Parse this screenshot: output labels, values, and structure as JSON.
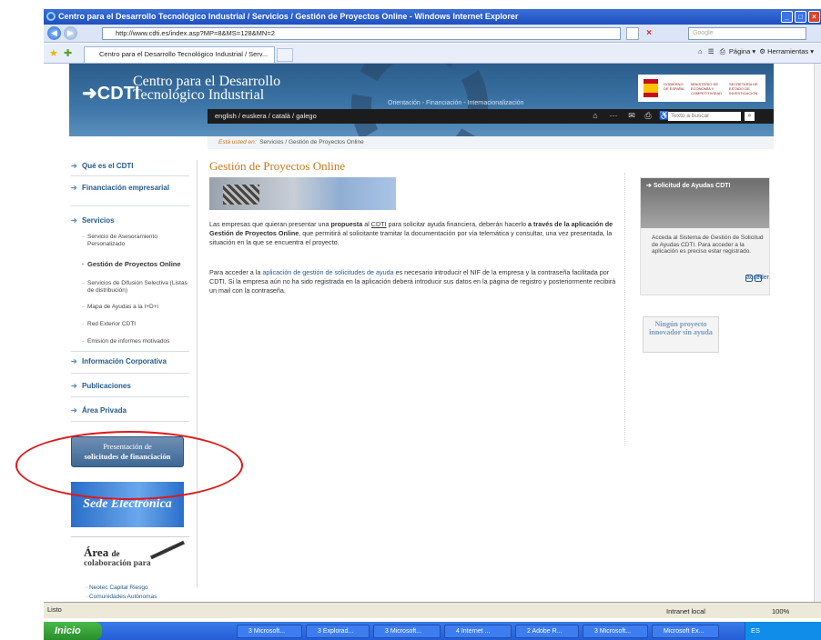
{
  "window": {
    "title": "Centro para el Desarrollo Tecnológico Industrial / Servicios / Gestión de Proyectos Online - Windows Internet Explorer"
  },
  "browser": {
    "url": "http://www.cdti.es/index.asp?MP=8&MS=128&MN=2",
    "search_placeholder": "Google",
    "tab_label": "Centro para el Desarrollo Tecnológico Industrial / Serv...",
    "page_menu": "Página",
    "tools_menu": "Herramientas"
  },
  "site": {
    "logo": "CDTI",
    "org_name": "Centro para el Desarrollo Tecnológico Industrial",
    "tagline": "Orientación - Financiación - Internacionalización",
    "gov_text_1": "GOBIERNO DE ESPAÑA",
    "gov_text_2": "MINISTERIO DE ECONOMÍA Y COMPETITIVIDAD",
    "gov_text_3": "SECRETARÍA DE ESTADO DE INVESTIGACIÓN",
    "languages": "english / euskera / català / galego",
    "search_placeholder": "Texto a buscar",
    "breadcrumb_prefix": "Está usted en:",
    "breadcrumb_path": "Servicios / Gestión de Proyectos Online"
  },
  "sidebar": {
    "que_es": "Qué es el CDTI",
    "financiacion": "Financiación empresarial",
    "servicios": "Servicios",
    "sub": {
      "asesoramiento": "Servicio de Asesoramiento Personalizado",
      "gestion": "Gestión de Proyectos Online",
      "difusion": "Servicios de Difusión Selectiva (Listas de distribución)",
      "mapa": "Mapa de Ayudas a la I+D+i",
      "red": "Red Exterior CDTI",
      "emision": "Emisión de informes motivados"
    },
    "info_corp": "Información Corporativa",
    "publicaciones": "Publicaciones",
    "area_privada": "Área Privada",
    "presentacion_1": "Presentación de",
    "presentacion_2": "solicitudes de financiación",
    "sede": "Sede Electrónica",
    "area_title": "Área",
    "area_de": "de",
    "area_sub": "colaboración para",
    "link_1": "· Neotec Capital Riesgo",
    "link_2": "· Comunidades Autónomas"
  },
  "main": {
    "title": "Gestión de Proyectos Online",
    "p1": {
      "a": "Las empresas que quieran presentar una ",
      "b": "propuesta",
      "c": " al ",
      "d": "CDTI",
      "e": " para solicitar ayuda financiera, deberán hacerlo ",
      "f": "a través de la aplicación de Gestión de Proyectos Online",
      "g": ", que permitirá al solicitante tramitar la documentación por vía telemática y consultar, una vez presentada, la situación en la que se encuentra el proyecto."
    },
    "p2": {
      "a": "Para acceder a la ",
      "b": "aplicación de gestión de solicitudes de ayuda",
      "c": " es necesario introducir el NIF de la empresa y la contraseña facilitada por CDTI. Si la empresa aún no ha sido registrada en la aplicación deberá introducir sus datos en la página de registro y posteriormente recibirá un mail con la contraseña."
    }
  },
  "right": {
    "box_title": "Solicitud de Ayudas CDTI",
    "box_text": "Acceda al Sistema de Gestión de Solicitud de Ayudas CDTI. Para acceder a la aplicación es preciso estar registrado.",
    "acceder": "acceder",
    "ningun": "Ningún proyecto innovador sin ayuda"
  },
  "status": {
    "left": "Listo",
    "zone": "Intranet local",
    "zoom": "100%"
  },
  "taskbar": {
    "start": "Inicio",
    "items": [
      "3 Microsoft...",
      "3 Explorad...",
      "3 Microsoft...",
      "4 Internet ...",
      "2 Adobe R...",
      "3 Microsoft...",
      "Microsoft Ex..."
    ],
    "tray": "ES"
  }
}
